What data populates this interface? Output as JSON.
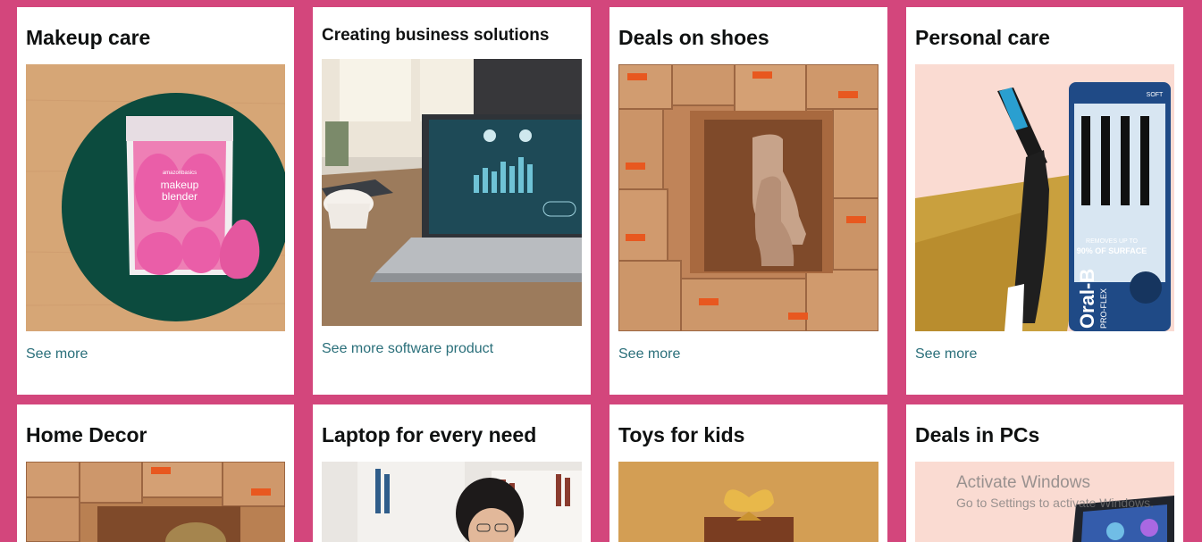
{
  "cards_row1": [
    {
      "title": "Makeup care",
      "link": "See more",
      "image": "makeup-blender-photo"
    },
    {
      "title": "Creating business solutions",
      "link": "See more software product",
      "image": "laptop-dashboard-photo"
    },
    {
      "title": "Deals on shoes",
      "link": "See more",
      "image": "boots-in-boxes-photo"
    },
    {
      "title": "Personal care",
      "link": "See more",
      "image": "toothbrush-pack-photo"
    }
  ],
  "cards_row2": [
    {
      "title": "Home Decor",
      "image": "boxes-photo"
    },
    {
      "title": "Laptop for every need",
      "image": "woman-laptop-photo"
    },
    {
      "title": "Toys for kids",
      "image": "gift-box-photo"
    },
    {
      "title": "Deals in PCs",
      "image": "gaming-pc-photo"
    }
  ],
  "product_text": {
    "amazon_basics": "amazonbasics",
    "blender_line1": "makeup",
    "blender_line2": "blender",
    "brand_oralb": "Oral-B",
    "pro_flex": "PRO-FLEX",
    "removes_line1": "REMOVES UP TO",
    "removes_line2": "90% OF SURFACE",
    "soft": "SOFT"
  },
  "watermark": {
    "line1": "Activate Windows",
    "line2": "Go to Settings to activate Windows."
  },
  "colors": {
    "background": "#d3467c",
    "card": "#ffffff",
    "link": "#2a6f7a"
  }
}
